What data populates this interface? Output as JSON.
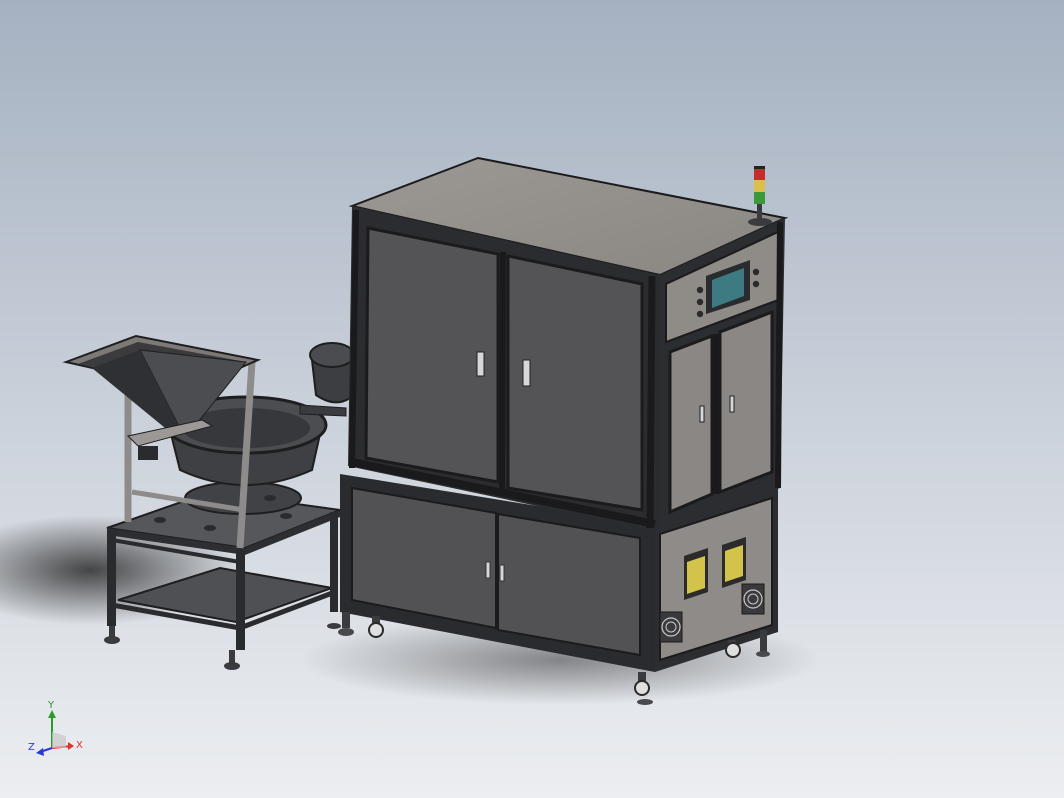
{
  "viewport": {
    "background_top": "#a7b3c2",
    "background_bottom": "#e6e8ec"
  },
  "triad": {
    "x_label": "X",
    "y_label": "Y",
    "z_label": "Z",
    "x_color": "#e0302a",
    "y_color": "#2a9a2a",
    "z_color": "#2a3ad0"
  },
  "model": {
    "frame_color": "#2a2b2e",
    "panel_color": "#4a4a4c",
    "top_color": "#9a9690",
    "panel_light": "#8a8784",
    "screen_color": "#3f7f86",
    "fan_color": "#c9c9c9",
    "label_yellow": "#d9c84a",
    "tower_red": "#c0302a",
    "tower_yellow": "#d9c04a",
    "tower_green": "#3a9a3a"
  }
}
